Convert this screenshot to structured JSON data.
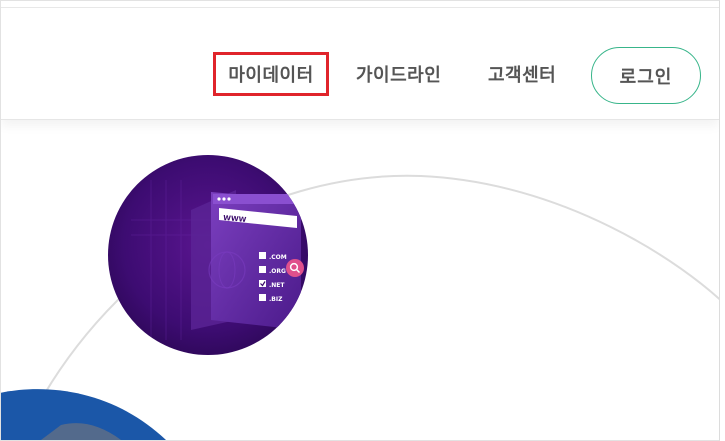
{
  "nav": {
    "items": [
      {
        "label": "마이데이터",
        "highlighted": true
      },
      {
        "label": "가이드라인"
      },
      {
        "label": "고객센터"
      }
    ],
    "login_label": "로그인"
  },
  "hero": {
    "illustration": {
      "browser_label": "WWW",
      "domains": [
        {
          "label": ".COM",
          "checked": false
        },
        {
          "label": ".ORG",
          "checked": false
        },
        {
          "label": ".NET",
          "checked": true
        },
        {
          "label": ".BIZ",
          "checked": false
        }
      ]
    }
  },
  "colors": {
    "highlight_border": "#e0242b",
    "login_border": "#38b58a",
    "nav_text": "#555555",
    "circle_purple": "#3a0a6b",
    "blue_shape": "#1b57a8"
  },
  "icons": {
    "search": "magnifier-icon",
    "checkbox": "checkbox-icon"
  }
}
